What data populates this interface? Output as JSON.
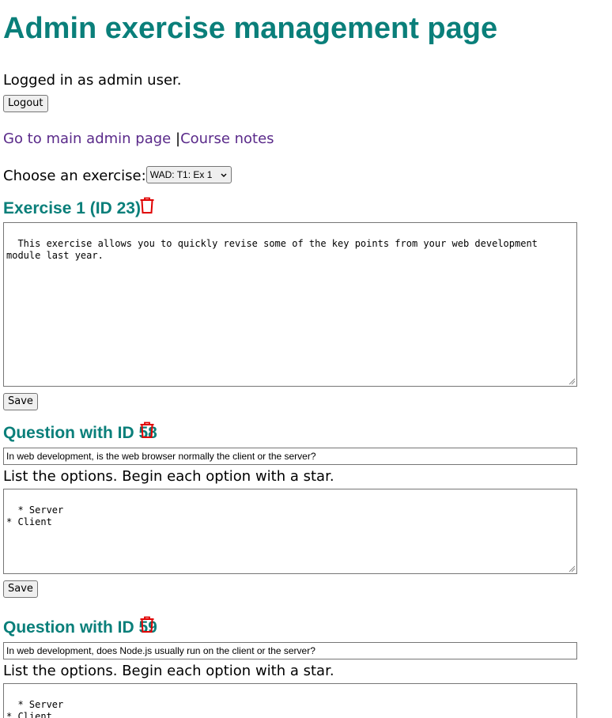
{
  "page": {
    "title": "Admin exercise management page",
    "status_text": "Logged in as admin user.",
    "logout_label": "Logout"
  },
  "nav": {
    "main_admin_link": "Go to main admin page",
    "separator": "|",
    "course_notes_link": "Course notes"
  },
  "exercise_picker": {
    "label": "Choose an exercise:",
    "selected": "WAD: T1: Ex 1"
  },
  "exercise": {
    "title": "Exercise 1 (ID 23)",
    "description": "This exercise allows you to quickly revise some of the key points from your web development module last year.",
    "save_label": "Save"
  },
  "questions": [
    {
      "title": "Question with ID 58",
      "text": "In web development, is the web browser normally the client or the server?",
      "options_label": "List the options. Begin each option with a star.",
      "options": "* Server\n* Client",
      "save_label": "Save"
    },
    {
      "title": "Question with ID 59",
      "text": "In web development, does Node.js usually run on the client or the server?",
      "options_label": "List the options. Begin each option with a star.",
      "options": "* Server\n* Client"
    }
  ],
  "colors": {
    "heading": "#0a7f7a",
    "link": "#5a2a8a",
    "delete_icon": "#e00000"
  },
  "icons": {
    "delete": "trash-icon",
    "resize": "resize-grip-icon",
    "dropdown": "chevron-down-icon"
  }
}
